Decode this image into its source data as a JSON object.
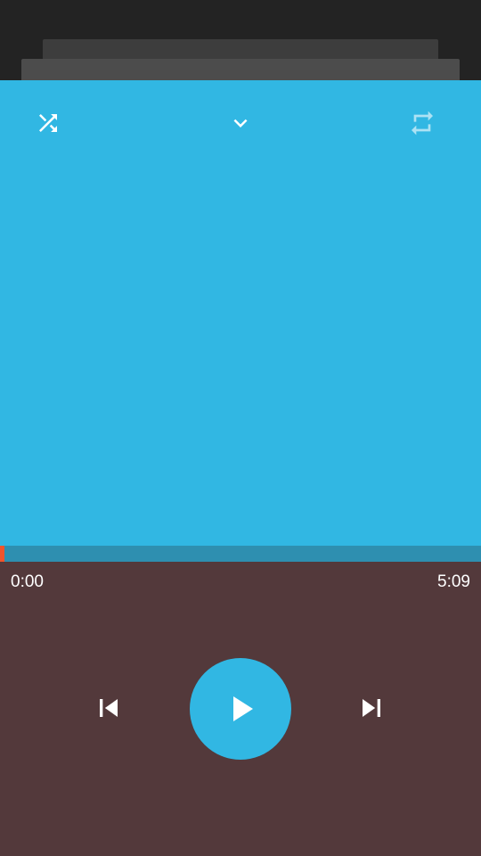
{
  "player": {
    "elapsed": "0:00",
    "duration": "5:09",
    "progress": 0.01
  },
  "icons": {
    "top_left": "shuffle-icon",
    "top_center": "chevron-down-icon",
    "top_right": "repeat-icon",
    "previous": "skip-previous-icon",
    "play": "play-icon",
    "next": "skip-next-icon"
  },
  "colors": {
    "accent": "#31b7e3",
    "controls_background": "#53393b",
    "progress": "#f0542c",
    "seek_track": "#2e8fb0"
  }
}
